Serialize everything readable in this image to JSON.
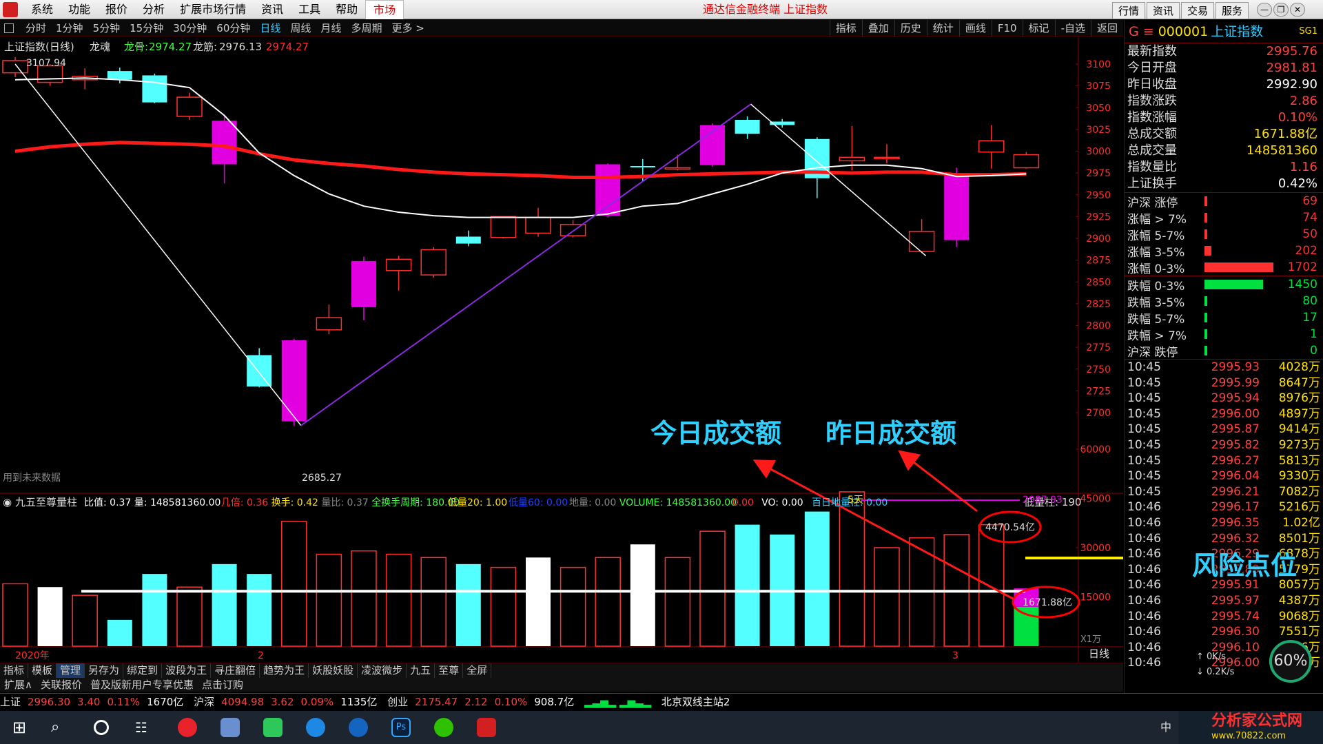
{
  "menubar": {
    "items": [
      "系统",
      "功能",
      "报价",
      "分析",
      "扩展市场行情",
      "资讯",
      "工具",
      "帮助",
      "市场"
    ],
    "app_title": "通达信金融终端 上证指数",
    "right_buttons": [
      "行情",
      "资讯",
      "交易",
      "服务"
    ]
  },
  "periodbar": {
    "periods": [
      "分时",
      "1分钟",
      "5分钟",
      "15分钟",
      "30分钟",
      "60分钟",
      "日线",
      "周线",
      "月线",
      "多周期",
      "更多 >"
    ],
    "active": "日线",
    "tools": [
      "指标",
      "叠加",
      "历史",
      "统计",
      "画线",
      "F10",
      "标记",
      "-自选",
      "返回"
    ]
  },
  "chart_header": {
    "name": "上证指数(日线)",
    "indicator": "龙魂",
    "longgu_label": "龙骨:",
    "longgu_value": "2974.27",
    "longjin_label": "龙筋:",
    "longjin_value": "2976.13",
    "extra_value": "2974.27"
  },
  "chart_notes": {
    "future_data": "用到未来数据"
  },
  "vol_header": {
    "name": "九五至尊量柱",
    "items": [
      {
        "t": "比值: 0.37",
        "c": "#ffffff"
      },
      {
        "t": "量: 148581360.00",
        "c": "#ffffff"
      },
      {
        "t": "几倍: 0.36",
        "c": "#ff3030"
      },
      {
        "t": "换手: 0.42",
        "c": "#ffe000"
      },
      {
        "t": "量比: 0.37",
        "c": "#888888"
      },
      {
        "t": "全换手周期: 180.00",
        "c": "#40ff40"
      },
      {
        "t": "低量20: 1.00",
        "c": "#ffe000"
      },
      {
        "t": "低量60: 0.00",
        "c": "#2040ff"
      },
      {
        "t": "地量: 0.00",
        "c": "#888888"
      },
      {
        "t": "VOLUME: 148581360.00",
        "c": "#40ff40"
      },
      {
        "t": "0.00",
        "c": "#ff3030"
      },
      {
        "t": "VO: 0.00",
        "c": "#ffffff"
      },
      {
        "t": "百日地量柱: 0.00",
        "c": "#3cf"
      }
    ],
    "low_vol": "低量柱: 190"
  },
  "annotations": {
    "today_amount": "今日成交额",
    "yesterday_amount": "昨日成交额",
    "risk_level": "风险点位",
    "five_days": "5天"
  },
  "chart_data": [
    {
      "type": "candlestick",
      "title": "上证指数(日线)",
      "y_ticks": [
        2700,
        2725,
        2750,
        2775,
        2800,
        2825,
        2850,
        2875,
        2900,
        2925,
        2950,
        2975,
        3000,
        3025,
        3050,
        3075,
        3100
      ],
      "ylim": [
        2680,
        3115
      ],
      "candles": [
        {
          "o": 3090,
          "c": 3104,
          "h": 3108,
          "l": 3085
        },
        {
          "o": 3079,
          "c": 3098,
          "h": 3100,
          "l": 3075
        },
        {
          "o": 3082,
          "c": 3086,
          "h": 3095,
          "l": 3071
        },
        {
          "o": 3092,
          "c": 3082,
          "h": 3096,
          "l": 3078
        },
        {
          "o": 3087,
          "c": 3056,
          "h": 3089,
          "l": 3055
        },
        {
          "o": 3040,
          "c": 3062,
          "h": 3067,
          "l": 3036
        },
        {
          "o": 3035,
          "c": 2985,
          "h": 3040,
          "l": 2963
        },
        {
          "o": 2766,
          "c": 2730,
          "h": 2774,
          "l": 2729
        },
        {
          "o": 2690,
          "c": 2783,
          "h": 2785,
          "l": 2685
        },
        {
          "o": 2795,
          "c": 2809,
          "h": 2824,
          "l": 2790
        },
        {
          "o": 2821,
          "c": 2874,
          "h": 2879,
          "l": 2806
        },
        {
          "o": 2863,
          "c": 2876,
          "h": 2880,
          "l": 2840
        },
        {
          "o": 2858,
          "c": 2887,
          "h": 2890,
          "l": 2855
        },
        {
          "o": 2902,
          "c": 2894,
          "h": 2909,
          "l": 2891
        },
        {
          "o": 2901,
          "c": 2925,
          "h": 2925,
          "l": 2900
        },
        {
          "o": 2906,
          "c": 2924,
          "h": 2935,
          "l": 2902
        },
        {
          "o": 2903,
          "c": 2916,
          "h": 2921,
          "l": 2901
        },
        {
          "o": 2926,
          "c": 2985,
          "h": 2986,
          "l": 2924
        },
        {
          "o": 2983,
          "c": 2982,
          "h": 2991,
          "l": 2966
        },
        {
          "o": 2980,
          "c": 2981,
          "h": 2996,
          "l": 2978
        },
        {
          "o": 2984,
          "c": 3030,
          "h": 3032,
          "l": 2982
        },
        {
          "o": 3036,
          "c": 3020,
          "h": 3040,
          "l": 3014
        },
        {
          "o": 3034,
          "c": 3030,
          "h": 3037,
          "l": 3027
        },
        {
          "o": 3014,
          "c": 2969,
          "h": 3016,
          "l": 2946
        },
        {
          "o": 2989,
          "c": 2993,
          "h": 3029,
          "l": 2978
        },
        {
          "o": 2993,
          "c": 2993,
          "h": 3008,
          "l": 2986
        },
        {
          "o": 2885,
          "c": 2908,
          "h": 2922,
          "l": 2883
        },
        {
          "o": 2898,
          "c": 2974,
          "h": 2981,
          "l": 2890
        },
        {
          "o": 2999,
          "c": 3012,
          "h": 3030,
          "l": 2980
        },
        {
          "o": 2981,
          "c": 2996,
          "h": 2999,
          "l": 2980
        }
      ],
      "ma_white": [
        3082,
        3083,
        3084,
        3082,
        3079,
        3073,
        3041,
        2998,
        2972,
        2951,
        2937,
        2930,
        2926,
        2924,
        2924,
        2924,
        2924,
        2928,
        2937,
        2940,
        2951,
        2962,
        2975,
        2981,
        2984,
        2984,
        2980,
        2971,
        2972,
        2974
      ],
      "ma_red": [
        3000,
        3005,
        3008,
        3010,
        3009,
        3008,
        3006,
        2997,
        2990,
        2986,
        2983,
        2979,
        2976,
        2974,
        2973,
        2972,
        2970,
        2970,
        2971,
        2973,
        2974,
        2975,
        2976,
        2976,
        2975,
        2976,
        2976,
        2973,
        2973,
        2974
      ],
      "high_label": "3107.94",
      "low_label": "2685.27"
    },
    {
      "type": "bar",
      "title": "九五至尊量柱",
      "y_ticks": [
        15000,
        30000,
        45000,
        60000
      ],
      "ylim": [
        0,
        70000
      ],
      "values": [
        19000,
        18000,
        15500,
        8000,
        22000,
        18000,
        25000,
        22000,
        38000,
        28000,
        29000,
        28000,
        27000,
        25000,
        24000,
        27000,
        24000,
        27000,
        31000,
        27000,
        35000,
        37000,
        34000,
        41000,
        47000,
        30000,
        33000,
        34000,
        37000,
        8000
      ],
      "last_bar_today": 12000,
      "ma_line": 44705,
      "reference_line": 16719,
      "label_4470": "4470.54亿",
      "label_2987": "2987.93",
      "label_1671": "1671.88亿",
      "x_labels": [
        "2020年",
        "2",
        "3"
      ],
      "period_label": "日线",
      "x1_label": "X1万"
    }
  ],
  "quote": {
    "code_prefix": "G ≡",
    "code": "000001",
    "name": "上证指数",
    "sg": "SG1",
    "rows": [
      {
        "label": "最新指数",
        "value": "2995.76",
        "cls": "r"
      },
      {
        "label": "今日开盘",
        "value": "2981.81",
        "cls": "r"
      },
      {
        "label": "昨日收盘",
        "value": "2992.90",
        "cls": "w"
      },
      {
        "label": "指数涨跌",
        "value": "2.86",
        "cls": "r"
      },
      {
        "label": "指数涨幅",
        "value": "0.10%",
        "cls": "r"
      },
      {
        "label": "总成交额",
        "value": "1671.88亿",
        "cls": "y"
      },
      {
        "label": "总成交量",
        "value": "148581360",
        "cls": "y"
      },
      {
        "label": "指数量比",
        "value": "1.16",
        "cls": "r"
      },
      {
        "label": "上证换手",
        "value": "0.42%",
        "cls": "w"
      }
    ],
    "dist": [
      {
        "label": "沪深 涨停",
        "count": "69",
        "frac": 0.03,
        "color": "#ff3030"
      },
      {
        "label": "涨幅 > 7%",
        "count": "74",
        "frac": 0.03,
        "color": "#ff3030"
      },
      {
        "label": "涨幅 5-7%",
        "count": "50",
        "frac": 0.02,
        "color": "#ff3030"
      },
      {
        "label": "涨幅 3-5%",
        "count": "202",
        "frac": 0.1,
        "color": "#ff3030"
      },
      {
        "label": "涨幅 0-3%",
        "count": "1702",
        "frac": 0.96,
        "color": "#ff3030"
      },
      {
        "label": "跌幅 0-3%",
        "count": "1450",
        "frac": 0.82,
        "color": "#00e040"
      },
      {
        "label": "跌幅 3-5%",
        "count": "80",
        "frac": 0.04,
        "color": "#00e040"
      },
      {
        "label": "跌幅 5-7%",
        "count": "17",
        "frac": 0.01,
        "color": "#00e040"
      },
      {
        "label": "跌幅 > 7%",
        "count": "1",
        "frac": 0.005,
        "color": "#00e040"
      },
      {
        "label": "沪深 跌停",
        "count": "0",
        "frac": 0.005,
        "color": "#00e040"
      }
    ],
    "ticks": [
      {
        "t": "10:45",
        "p": "2995.93",
        "v": "4028万"
      },
      {
        "t": "10:45",
        "p": "2995.99",
        "v": "8647万"
      },
      {
        "t": "10:45",
        "p": "2995.94",
        "v": "8976万"
      },
      {
        "t": "10:45",
        "p": "2996.00",
        "v": "4897万"
      },
      {
        "t": "10:45",
        "p": "2995.87",
        "v": "9414万"
      },
      {
        "t": "10:45",
        "p": "2995.82",
        "v": "9273万"
      },
      {
        "t": "10:45",
        "p": "2996.27",
        "v": "5813万"
      },
      {
        "t": "10:45",
        "p": "2996.04",
        "v": "9330万"
      },
      {
        "t": "10:45",
        "p": "2996.21",
        "v": "7082万"
      },
      {
        "t": "10:46",
        "p": "2996.17",
        "v": "5216万"
      },
      {
        "t": "10:46",
        "p": "2996.35",
        "v": "1.02亿"
      },
      {
        "t": "10:46",
        "p": "2996.32",
        "v": "8501万"
      },
      {
        "t": "10:46",
        "p": "2996.29",
        "v": "6878万"
      },
      {
        "t": "10:46",
        "p": "2995.89",
        "v": "5779万"
      },
      {
        "t": "10:46",
        "p": "2995.91",
        "v": "8057万"
      },
      {
        "t": "10:46",
        "p": "2995.97",
        "v": "4387万"
      },
      {
        "t": "10:46",
        "p": "2995.74",
        "v": "9068万"
      },
      {
        "t": "10:46",
        "p": "2996.30",
        "v": "7551万"
      },
      {
        "t": "10:46",
        "p": "2996.10",
        "v": "8846万"
      },
      {
        "t": "10:46",
        "p": "2996.00",
        "v": "6304万"
      }
    ],
    "speed_percent": "60%",
    "speed_up": "0K/s",
    "speed_down": "0.2K/s"
  },
  "bottom_tabs": [
    "指标",
    "模板",
    "管理",
    "另存为",
    "绑定到",
    "波段为王",
    "寻庄翻倍",
    "趋势为王",
    "妖股妖股",
    "凌波微步",
    "九五",
    "至尊",
    "全屏"
  ],
  "bottom_links": [
    "扩展∧",
    "关联报价",
    "普及版新用户专享优惠",
    "点击订购"
  ],
  "ticker": {
    "sh_label": "上证",
    "sh_value": "2996.30",
    "sh_chg": "3.40",
    "sh_pct": "0.11%",
    "sh_amt": "1670亿",
    "sz_label": "沪深",
    "sz_value": "4094.98",
    "sz_chg": "3.62",
    "sz_pct": "0.09%",
    "sz_amt": "1135亿",
    "cy_label": "创业",
    "cy_value": "2175.47",
    "cy_chg": "2.12",
    "cy_pct": "0.10%",
    "cy_amt": "908.7亿",
    "server": "北京双线主站2"
  },
  "taskbar": {
    "ime": "中",
    "watermark_name": "分析家公式网",
    "watermark_url": "www.70822.com"
  }
}
